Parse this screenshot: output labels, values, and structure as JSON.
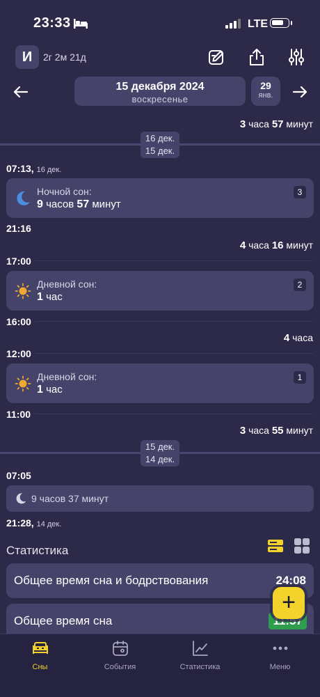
{
  "status_bar": {
    "time": "23:33",
    "network": "LTE"
  },
  "header": {
    "avatar_letter": "И",
    "age": "2г 2м 21д"
  },
  "date_nav": {
    "date": "15 декабря 2024",
    "weekday": "воскресенье",
    "next_day": "29",
    "next_month": "янв."
  },
  "timeline": {
    "top_duration": {
      "hours": "3",
      "h_word": "часа",
      "minutes": "57",
      "m_word": "минут"
    },
    "badge1": {
      "line1": "16 дек.",
      "line2": "15 дек."
    },
    "t1": {
      "time": "07:13,",
      "date": "16 дек."
    },
    "card1": {
      "title": "Ночной сон:",
      "h": "9",
      "h_word": "часов",
      "m": "57",
      "m_word": "минут",
      "count": "3"
    },
    "t2": "21:16",
    "d2": {
      "hours": "4",
      "h_word": "часа",
      "minutes": "16",
      "m_word": "минут"
    },
    "t3": "17:00",
    "card2": {
      "title": "Дневной сон:",
      "h": "1",
      "h_word": "час",
      "count": "2"
    },
    "t4": "16:00",
    "d4": {
      "hours": "4",
      "h_word": "часа"
    },
    "t5": "12:00",
    "card3": {
      "title": "Дневной сон:",
      "h": "1",
      "h_word": "час",
      "count": "1"
    },
    "t6": "11:00",
    "d6": {
      "hours": "3",
      "h_word": "часа",
      "minutes": "55",
      "m_word": "минут"
    },
    "badge2": {
      "line1": "15 дек.",
      "line2": "14 дек."
    },
    "t7": "07:05",
    "summary": "9 часов 37 минут",
    "t8": {
      "time": "21:28,",
      "date": "14 дек."
    }
  },
  "stats": {
    "title": "Статистика",
    "rows": [
      {
        "label": "Общее время сна и бодрствования",
        "value": "24:08"
      },
      {
        "label": "Общее время сна",
        "value": "11:57"
      }
    ]
  },
  "fab": "+",
  "tabs": [
    {
      "label": "Сны",
      "icon": "bed-icon"
    },
    {
      "label": "События",
      "icon": "calendar-icon"
    },
    {
      "label": "Статистика",
      "icon": "chart-icon"
    },
    {
      "label": "Меню",
      "icon": "more-icon"
    }
  ],
  "colors": {
    "background": "#2d2a49",
    "card": "#46436a",
    "accent": "#f3d22b",
    "moon": "#4a8fe0",
    "sun": "#f0a930",
    "green": "#2e9e4e"
  }
}
